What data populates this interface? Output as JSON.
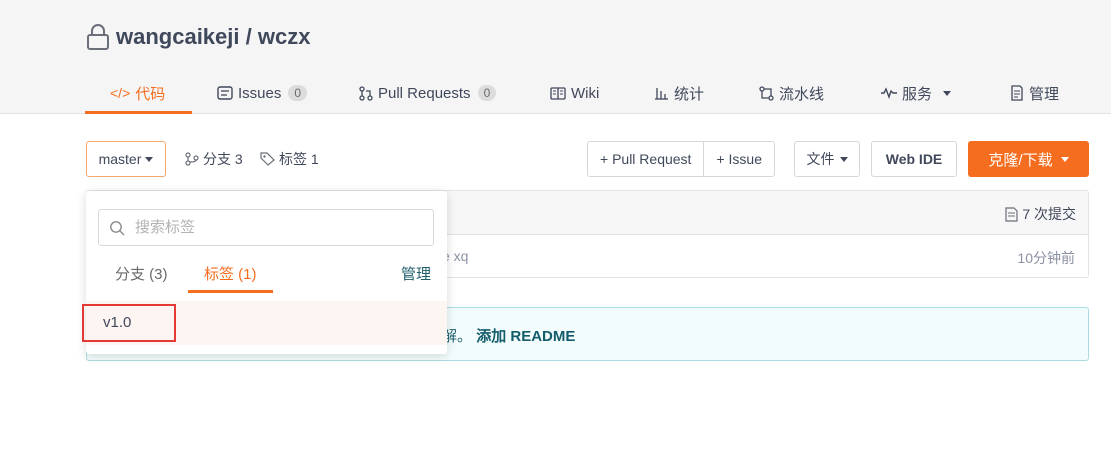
{
  "repo": {
    "title": "wangcaikeji / wczx"
  },
  "tabs": [
    {
      "label": "代码",
      "icon": "code-icon"
    },
    {
      "label": "Issues",
      "count": "0",
      "icon": "issues-icon"
    },
    {
      "label": "Pull Requests",
      "count": "0",
      "icon": "pull-request-icon"
    },
    {
      "label": "Wiki",
      "icon": "wiki-icon"
    },
    {
      "label": "统计",
      "icon": "stats-icon"
    },
    {
      "label": "流水线",
      "icon": "pipeline-icon"
    },
    {
      "label": "服务",
      "icon": "pulse-icon"
    },
    {
      "label": "管理",
      "icon": "manage-icon"
    }
  ],
  "toolbar": {
    "branch": "master",
    "branches_label": "分支 3",
    "tags_label": "标签 1",
    "new_pr": "+ Pull Request",
    "new_issue": "+ Issue",
    "file": "文件",
    "web_ide": "Web IDE",
    "clone": "克隆/下载"
  },
  "commit": {
    "count": "7 次提交",
    "message_fragment": "e xq",
    "time": "10分钟前"
  },
  "readme": {
    "text_fragment": "解。",
    "add_label": "添加 README"
  },
  "dropdown": {
    "search_placeholder": "搜索标签",
    "tab_branches": "分支 (3)",
    "tab_tags": "标签 (1)",
    "manage": "管理",
    "tags": [
      "v1.0"
    ]
  },
  "colors": {
    "accent": "#f56e1f",
    "highlight": "#e53935"
  }
}
